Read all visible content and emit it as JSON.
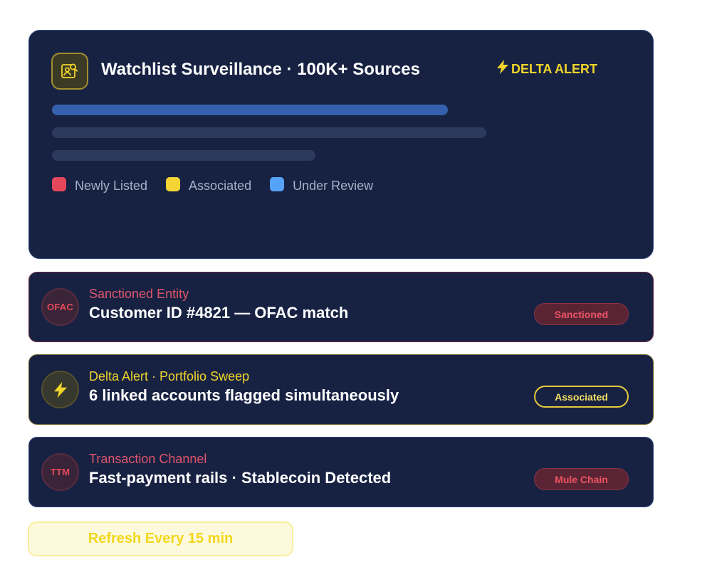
{
  "colors": {
    "card_background": "#172243",
    "accent_yellow": "#f2d52b",
    "accent_red": "#e5485b",
    "bar_blue": "#3560ad",
    "bar_gray": "#2c3a5d"
  },
  "header": {
    "icon": "user-search-icon",
    "title": "Watchlist Surveillance · 100K+ Sources",
    "alert_icon": "lightning-bolt-icon",
    "alert_label": "DELTA ALERT"
  },
  "legend": [
    {
      "label": "Newly Listed",
      "color": "#e5485b"
    },
    {
      "label": "Associated",
      "color": "#f4d534"
    },
    {
      "label": "Under Review",
      "color": "#56a2f7"
    }
  ],
  "alerts": [
    {
      "badge_text": "OFAC",
      "category": "Sanctioned Entity",
      "category_color": "#e0556a",
      "main": "Customer ID #4821 — OFAC match",
      "pill": "Sanctioned"
    },
    {
      "badge_icon": "lightning-bolt-icon",
      "category": "Delta Alert · Portfolio Sweep",
      "category_color": "#f2d52b",
      "main": "6 linked accounts flagged simultaneously",
      "pill": "Associated"
    },
    {
      "badge_text": "TTM",
      "category": "Transaction Channel",
      "category_color": "#e0556a",
      "main": "Fast-payment rails · Stablecoin Detected",
      "pill": "Mule Chain"
    }
  ],
  "footer": {
    "refresh_label": "Refresh Every 15 min"
  }
}
